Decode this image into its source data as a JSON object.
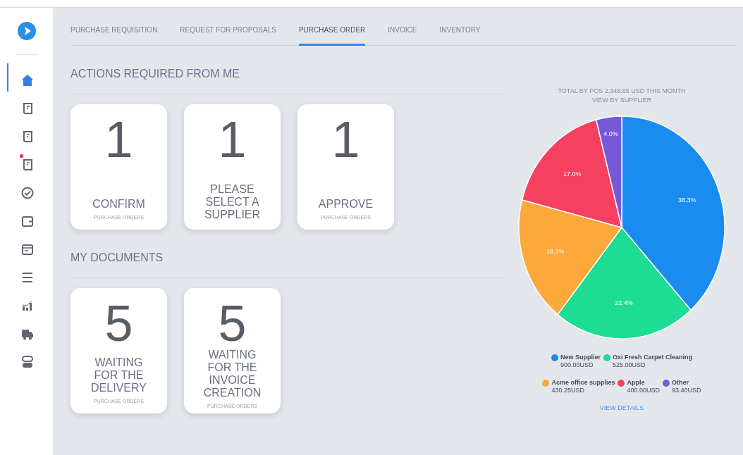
{
  "sidebar": {
    "items": [
      {
        "kind": "home",
        "selected": true,
        "notification": false
      },
      {
        "kind": "scroll",
        "selected": false,
        "notification": false
      },
      {
        "kind": "scroll",
        "selected": false,
        "notification": false
      },
      {
        "kind": "scroll",
        "selected": false,
        "notification": true
      },
      {
        "kind": "check",
        "selected": false,
        "notification": false
      },
      {
        "kind": "wallet",
        "selected": false,
        "notification": false
      },
      {
        "kind": "card",
        "selected": false,
        "notification": false
      },
      {
        "kind": "menu",
        "selected": false,
        "notification": false
      },
      {
        "kind": "chart",
        "selected": false,
        "notification": false
      },
      {
        "kind": "truck",
        "selected": false,
        "notification": false
      },
      {
        "kind": "toggle",
        "selected": false,
        "notification": false
      }
    ]
  },
  "tabs": [
    {
      "label": "PURCHASE REQUISITION",
      "selected": false
    },
    {
      "label": "REQUEST FOR PROPOSALS",
      "selected": false
    },
    {
      "label": "PURCHASE ORDER",
      "selected": true
    },
    {
      "label": "INVOICE",
      "selected": false
    },
    {
      "label": "INVENTORY",
      "selected": false
    }
  ],
  "sections": [
    {
      "title": "ACTIONS REQUIRED FROM ME",
      "tiles": [
        {
          "count": "1",
          "title": "CONFIRM",
          "subtitle": "PURCHASE ORDERS"
        },
        {
          "count": "1",
          "title": "PLEASE SELECT A SUPPLIER"
        },
        {
          "count": "1",
          "title": "APPROVE",
          "subtitle": "PURCHASE ORDERS"
        }
      ]
    },
    {
      "title": "MY DOCUMENTS",
      "tiles": [
        {
          "count": "5",
          "title": "WAITING FOR THE DELIVERY",
          "subtitle": "PURCHASE ORDERS"
        },
        {
          "count": "5",
          "title": "WAITING FOR THE INVOICE CREATION",
          "subtitle": "PURCHASE ORDERS"
        }
      ]
    }
  ],
  "summary": {
    "total": "TOTAL BY POS 2,348.65 USD THIS MONTH",
    "view": "VIEW BY SUPPLIER",
    "chart_data": {
      "type": "pie",
      "categories": [
        "New Supplier",
        "Oxi Fresh Carpet Cleaning",
        "Acme office supplies",
        "Apple",
        "Other"
      ],
      "values": [
        38.3,
        22.4,
        18.3,
        17.0,
        4.0
      ],
      "value_labels": [
        "38.3%",
        "22.4%",
        "18.3%",
        "17.0%",
        "4.0%"
      ]
    },
    "legend_rows": [
      {
        "items": [
          {
            "amount": "900.00USD",
            "color": "#1a8cf0"
          },
          {
            "amount": "525.00USD",
            "color": "#1ddc94"
          }
        ]
      },
      {
        "items": [
          {
            "amount": "430.25USD",
            "color": "#fba93a"
          },
          {
            "amount": "400.00USD",
            "color": "#f5405f"
          },
          {
            "amount": "93.40USD",
            "color": "#7559d6"
          }
        ]
      }
    ],
    "link": "VIEW DETAILS"
  }
}
